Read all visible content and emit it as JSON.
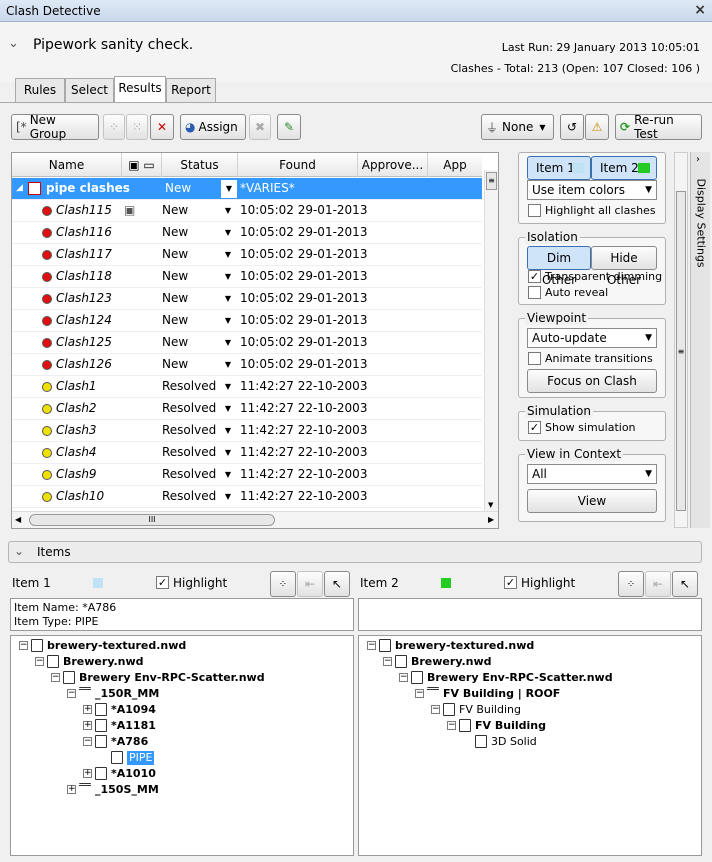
{
  "window": {
    "title": "Clash Detective",
    "close": "×"
  },
  "test": {
    "name": "Pipework sanity check.",
    "last_run": "Last Run:  29 January 2013 10:05:01",
    "clashes": "Clashes - Total:  213  (Open:  107  Closed:  106 )"
  },
  "tabs": [
    "Rules",
    "Select",
    "Results",
    "Report"
  ],
  "toolbar": {
    "new_group": "New Group",
    "assign": "Assign",
    "none": "None",
    "rerun": "Re-run Test"
  },
  "grid": {
    "columns": [
      "Name",
      "Status",
      "Found",
      "Approve...",
      "App"
    ],
    "group": {
      "name": "pipe clashes",
      "status": "New",
      "found": "*VARIES*"
    },
    "rows": [
      {
        "name": "Clash115",
        "status": "New",
        "found": "10:05:02 29-01-2013",
        "color": "#e01010"
      },
      {
        "name": "Clash116",
        "status": "New",
        "found": "10:05:02 29-01-2013",
        "color": "#e01010"
      },
      {
        "name": "Clash117",
        "status": "New",
        "found": "10:05:02 29-01-2013",
        "color": "#e01010"
      },
      {
        "name": "Clash118",
        "status": "New",
        "found": "10:05:02 29-01-2013",
        "color": "#e01010"
      },
      {
        "name": "Clash123",
        "status": "New",
        "found": "10:05:02 29-01-2013",
        "color": "#e01010"
      },
      {
        "name": "Clash124",
        "status": "New",
        "found": "10:05:02 29-01-2013",
        "color": "#e01010"
      },
      {
        "name": "Clash125",
        "status": "New",
        "found": "10:05:02 29-01-2013",
        "color": "#e01010"
      },
      {
        "name": "Clash126",
        "status": "New",
        "found": "10:05:02 29-01-2013",
        "color": "#e01010"
      },
      {
        "name": "Clash1",
        "status": "Resolved",
        "found": "11:42:27 22-10-2003",
        "color": "#f0e000"
      },
      {
        "name": "Clash2",
        "status": "Resolved",
        "found": "11:42:27 22-10-2003",
        "color": "#f0e000"
      },
      {
        "name": "Clash3",
        "status": "Resolved",
        "found": "11:42:27 22-10-2003",
        "color": "#f0e000"
      },
      {
        "name": "Clash4",
        "status": "Resolved",
        "found": "11:42:27 22-10-2003",
        "color": "#f0e000"
      },
      {
        "name": "Clash9",
        "status": "Resolved",
        "found": "11:42:27 22-10-2003",
        "color": "#f0e000"
      },
      {
        "name": "Clash10",
        "status": "Resolved",
        "found": "11:42:27 22-10-2003",
        "color": "#f0e000"
      }
    ],
    "hscroll": "III"
  },
  "display": {
    "item1": "Item 1",
    "item2": "Item 2",
    "colors": "Use item colors",
    "highlight_all": "Highlight all clashes",
    "isolation": "Isolation",
    "dim_other": "Dim Other",
    "hide_other": "Hide Other",
    "transparent": "Transparent dimming",
    "auto_reveal": "Auto reveal",
    "viewpoint": "Viewpoint",
    "auto_update": "Auto-update",
    "animate": "Animate transitions",
    "focus": "Focus on Clash",
    "simulation": "Simulation",
    "show_sim": "Show simulation",
    "context": "View in Context",
    "context_value": "All",
    "view": "View",
    "side_tab": "Display Settings"
  },
  "items": {
    "header": "Items",
    "item1_label": "Item 1",
    "item2_label": "Item 2",
    "highlight": "Highlight",
    "item1_color": "#bfe3f5",
    "item2_color": "#22cc22",
    "info1": "Item Name: *A786",
    "info2": "Item Type: PIPE",
    "tree1": [
      "brewery-textured.nwd",
      "Brewery.nwd",
      "Brewery Env-RPC-Scatter.nwd",
      "_150R_MM",
      "*A1094",
      "*A1181",
      "*A786",
      "PIPE",
      "*A1010",
      "_150S_MM"
    ],
    "tree2": [
      "brewery-textured.nwd",
      "Brewery.nwd",
      "Brewery Env-RPC-Scatter.nwd",
      "FV Building | ROOF",
      "FV Building",
      "FV Building",
      "3D Solid"
    ]
  }
}
